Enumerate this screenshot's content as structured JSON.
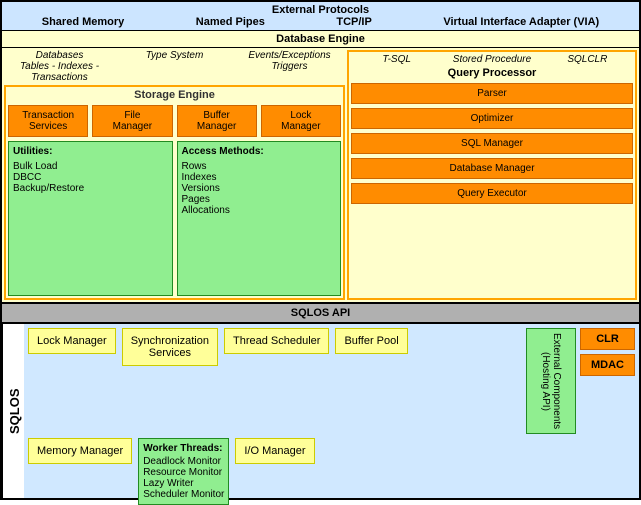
{
  "externalProtocols": {
    "label": "External Protocols",
    "items": [
      "Shared Memory",
      "Named Pipes",
      "TCP/IP",
      "Virtual Interface Adapter (VIA)"
    ]
  },
  "databaseEngine": {
    "label": "Database Engine",
    "leftHeaders": [
      "Databases\nTables - Indexes - Transactions",
      "Type System",
      "Events/Exceptions\nTriggers"
    ],
    "storageEngine": {
      "label": "Storage Engine",
      "topBoxes": [
        "Transaction\nServices",
        "File\nManager",
        "Buffer\nManager",
        "Lock\nManager"
      ],
      "utilities": {
        "title": "Utilities:",
        "items": [
          "Bulk Load",
          "DBCC",
          "Backup/Restore"
        ]
      },
      "accessMethods": {
        "title": "Access Methods:",
        "items": [
          "Rows",
          "Indexes",
          "Versions",
          "Pages",
          "Allocations"
        ]
      }
    },
    "rightHeaders": [
      "T-SQL",
      "Stored Procedure",
      "SQLCLR"
    ],
    "queryProcessor": {
      "label": "Query Processor",
      "boxes": [
        "Parser",
        "Optimizer",
        "SQL Manager",
        "Database Manager",
        "Query Executor"
      ]
    }
  },
  "sqlosApi": {
    "label": "SQLOS API"
  },
  "sqlos": {
    "sectionLabel": "SQLOS",
    "topRow": {
      "boxes": [
        "Lock Manager",
        "Synchronization\nServices",
        "Thread Scheduler",
        "Buffer Pool"
      ]
    },
    "bottomRow": {
      "memoryManager": "Memory Manager",
      "workerThreads": {
        "title": "Worker Threads:",
        "items": [
          "Deadlock Monitor",
          "Resource Monitor",
          "Lazy Writer",
          "Scheduler Monitor"
        ]
      },
      "ioManager": "I/O Manager"
    },
    "externalComponents": {
      "label": "External Components\n(Hosting API)",
      "boxes": [
        "CLR",
        "MDAC"
      ]
    }
  }
}
